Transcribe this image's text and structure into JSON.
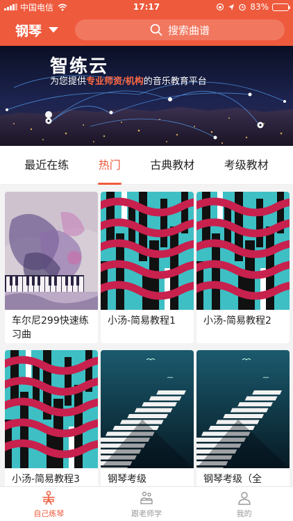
{
  "status_bar": {
    "carrier": "中国电信",
    "time": "17:17",
    "battery": "83%",
    "battery_level": 0.83
  },
  "header": {
    "instrument_label": "钢琴",
    "search_placeholder": "搜索曲谱"
  },
  "banner": {
    "title": "智练云",
    "subtitle_prefix": "为您提供",
    "subtitle_highlight": "专业师资/机构",
    "subtitle_suffix": "的音乐教育平台"
  },
  "tabs": [
    {
      "label": "最近在练",
      "active": false
    },
    {
      "label": "热门",
      "active": true
    },
    {
      "label": "古典教材",
      "active": false
    },
    {
      "label": "考级教材",
      "active": false
    }
  ],
  "cards": [
    {
      "title": "车尔尼299快速练习曲",
      "cover": "watercolor-piano"
    },
    {
      "title": "小汤-简易教程1",
      "cover": "wave-keys"
    },
    {
      "title": "小汤-简易教程2",
      "cover": "wave-keys"
    },
    {
      "title": "小汤-简易教程3",
      "cover": "wave-keys"
    },
    {
      "title": "钢琴考级",
      "cover": "night-keys"
    },
    {
      "title": "钢琴考级（全",
      "cover": "night-keys"
    }
  ],
  "bottom_nav": [
    {
      "label": "自己练琴",
      "icon": "practice-icon",
      "active": true
    },
    {
      "label": "跟老师学",
      "icon": "teacher-icon",
      "active": false
    },
    {
      "label": "我的",
      "icon": "profile-icon",
      "active": false
    }
  ],
  "colors": {
    "accent": "#ee5a3c",
    "wave_red": "#c8214e",
    "teal": "#3ebfc4"
  }
}
